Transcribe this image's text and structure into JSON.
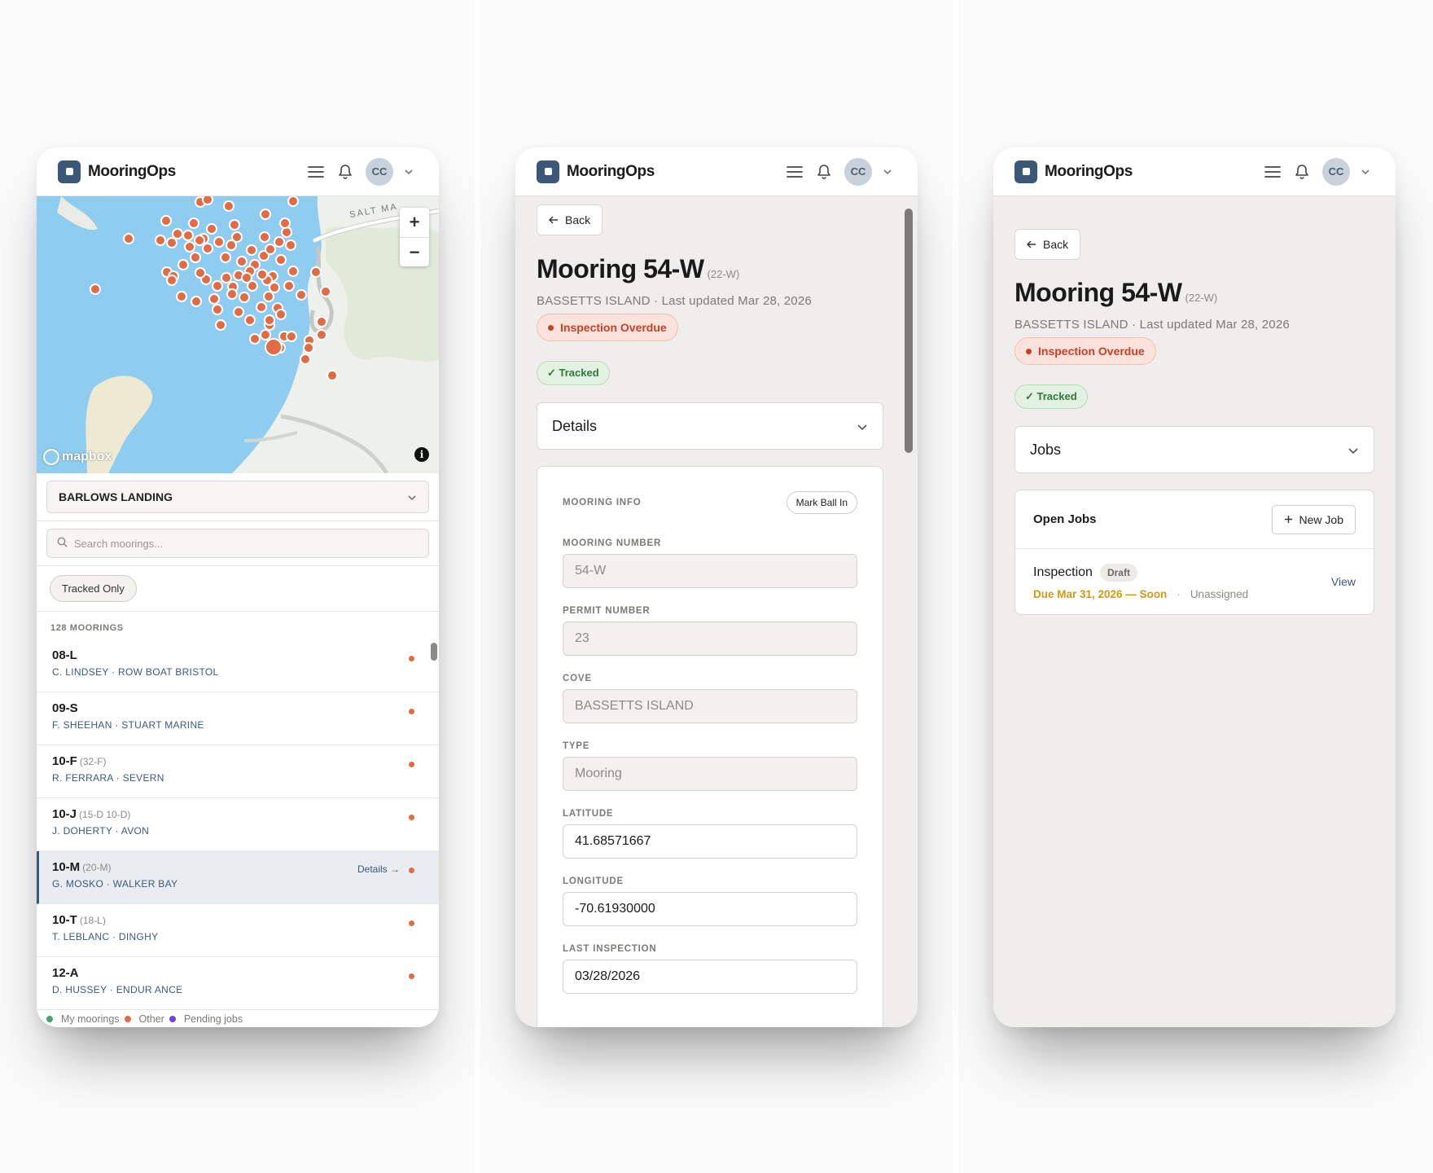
{
  "app": {
    "brand": "MooringOps",
    "avatar_initials": "CC",
    "accent": "#3c5878"
  },
  "map_screen": {
    "road_label": "SALT MA",
    "zoom_in": "+",
    "zoom_out": "−",
    "attribution": "mapbox",
    "cove_selected": "BARLOWS LANDING",
    "search_placeholder": "Search moorings...",
    "filter_chip": "Tracked Only",
    "count_label": "128 MOORINGS",
    "rows": [
      {
        "number": "08-L",
        "alias": "",
        "owner": "C. LINDSEY · ROW BOAT BRISTOL",
        "details": ""
      },
      {
        "number": "09-S",
        "alias": "",
        "owner": "F. SHEEHAN · STUART MARINE",
        "details": ""
      },
      {
        "number": "10-F",
        "alias": "(32-F)",
        "owner": "R. FERRARA · SEVERN",
        "details": ""
      },
      {
        "number": "10-J",
        "alias": "(15-D 10-D)",
        "owner": "J. DOHERTY · AVON",
        "details": ""
      },
      {
        "number": "10-M",
        "alias": "(20-M)",
        "owner": "G. MOSKO · WALKER BAY",
        "details": "Details →"
      },
      {
        "number": "10-T",
        "alias": "(18-L)",
        "owner": "T. LEBLANC · DINGHY",
        "details": ""
      },
      {
        "number": "12-A",
        "alias": "",
        "owner": "D. HUSSEY · ENDUR ANCE",
        "details": ""
      }
    ],
    "legend": [
      {
        "label": "My moorings",
        "color": "#3fa86a"
      },
      {
        "label": "Other",
        "color": "#e06b45"
      },
      {
        "label": "Pending jobs",
        "color": "#7b3fe0"
      }
    ]
  },
  "detail_screen": {
    "back_label": "Back",
    "title": "Mooring 54-W",
    "alias": "(22-W)",
    "subtitle": "BASSETTS ISLAND · Last updated Mar 28, 2026",
    "status_badge": "Inspection Overdue",
    "tracked_badge": "✓ Tracked",
    "section_toggle": "Details",
    "section_header": "MOORING INFO",
    "mark_ball_label": "Mark Ball In",
    "fields": [
      {
        "label": "MOORING NUMBER",
        "value": "54-W"
      },
      {
        "label": "PERMIT NUMBER",
        "value": "23"
      },
      {
        "label": "COVE",
        "value": "BASSETTS ISLAND"
      },
      {
        "label": "TYPE",
        "value": "Mooring"
      },
      {
        "label": "LATITUDE",
        "value": "41.68571667"
      },
      {
        "label": "LONGITUDE",
        "value": "-70.61930000"
      },
      {
        "label": "LAST INSPECTION",
        "value": "03/28/2026"
      }
    ]
  },
  "jobs_screen": {
    "back_label": "Back",
    "title": "Mooring 54-W",
    "alias": "(22-W)",
    "subtitle": "BASSETTS ISLAND · Last updated Mar 28, 2026",
    "status_badge": "Inspection Overdue",
    "tracked_badge": "✓ Tracked",
    "section_toggle": "Jobs",
    "open_jobs_title": "Open Jobs",
    "new_job_label": "New Job",
    "job": {
      "title": "Inspection",
      "status": "Draft",
      "due": "Due Mar 31, 2026 — Soon",
      "separator": "·",
      "assignee": "Unassigned",
      "view_label": "View"
    }
  }
}
